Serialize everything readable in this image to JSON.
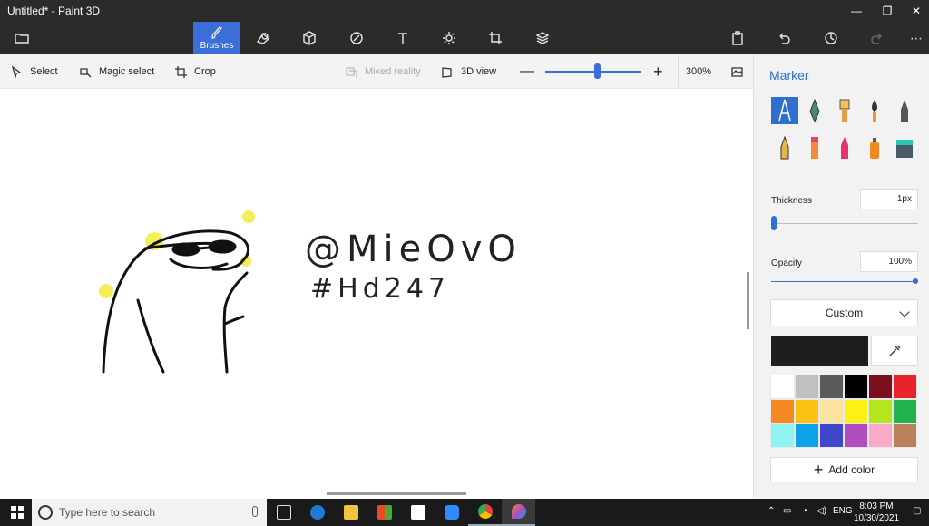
{
  "window": {
    "title": "Untitled* - Paint 3D"
  },
  "toolbar": {
    "active_tool_label": "Brushes",
    "tools": [
      "menu-icon",
      "brushes-icon",
      "2d-shapes-icon",
      "3d-shapes-icon",
      "stickers-icon",
      "text-icon",
      "effects-icon",
      "canvas-icon",
      "3d-library-icon",
      "paste-icon",
      "undo-icon",
      "history-icon",
      "redo-icon",
      "more-icon"
    ]
  },
  "subbar": {
    "select_label": "Select",
    "magic_select_label": "Magic select",
    "crop_label": "Crop",
    "mixed_reality_label": "Mixed reality",
    "view_3d_label": "3D view",
    "zoom_level": "300%",
    "zoom_fraction": 0.55
  },
  "canvas": {
    "handwriting_line1": "@MieOvO",
    "handwriting_line2": "#Hd247"
  },
  "panel": {
    "title": "Marker",
    "brushes": [
      "marker",
      "calligraphy-pen",
      "oil-brush",
      "watercolor",
      "pencil",
      "pixel-pen",
      "pencil-crayon",
      "crayon",
      "spray-can",
      "fill"
    ],
    "thickness_label": "Thickness",
    "thickness_value": "1px",
    "opacity_label": "Opacity",
    "opacity_value": "100%",
    "color_mode": "Custom",
    "add_color_label": "Add color",
    "current_color": "#1e1e1e",
    "palette": [
      "#ffffff",
      "#c0c0c0",
      "#5a5a5a",
      "#000000",
      "#7a0f1e",
      "#e8232b",
      "#f58a22",
      "#fbc215",
      "#fbe49e",
      "#fbf115",
      "#b5e61d",
      "#23b14d",
      "#8ff3f4",
      "#0aa2e8",
      "#3f48cc",
      "#b04dbf",
      "#f9a9c9",
      "#b98059"
    ]
  },
  "taskbar": {
    "search_placeholder": "Type here to search",
    "language": "ENG",
    "time": "8:03 PM",
    "date": "10/30/2021"
  }
}
